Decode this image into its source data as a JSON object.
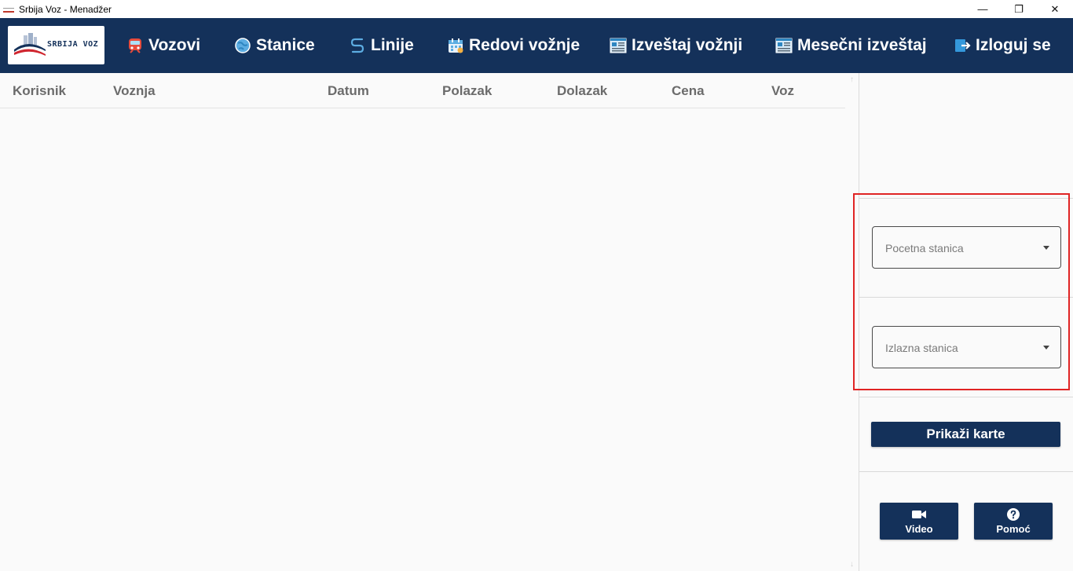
{
  "window": {
    "title": "Srbija Voz - Menadžer",
    "controls": {
      "minimize": "—",
      "restore": "❐",
      "close": "✕"
    }
  },
  "logo": {
    "text": "SRBIJA VOZ"
  },
  "nav": [
    {
      "label": "Vozovi",
      "icon": "train-icon"
    },
    {
      "label": "Stanice",
      "icon": "globe-icon"
    },
    {
      "label": "Linije",
      "icon": "route-icon"
    },
    {
      "label": "Redovi vožnje",
      "icon": "calendar-icon"
    },
    {
      "label": "Izveštaj vožnji",
      "icon": "report-icon"
    },
    {
      "label": "Mesečni izveštaj",
      "icon": "monthly-report-icon"
    },
    {
      "label": "Izloguj se",
      "icon": "logout-icon"
    }
  ],
  "table": {
    "columns": [
      "Korisnik",
      "Voznja",
      "Datum",
      "Polazak",
      "Dolazak",
      "Cena",
      "Voz"
    ],
    "rows": []
  },
  "filters": {
    "start_station": {
      "placeholder": "Pocetna stanica"
    },
    "end_station": {
      "placeholder": "Izlazna stanica"
    }
  },
  "actions": {
    "show_tickets": "Prikaži karte",
    "video": "Video",
    "help": "Pomoć"
  },
  "colors": {
    "brand_navy": "#14315a",
    "highlight_red": "#e02424"
  }
}
